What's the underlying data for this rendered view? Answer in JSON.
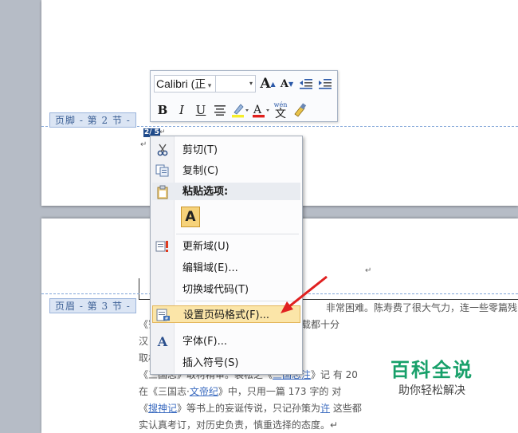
{
  "document": {
    "footer_tag": "页脚 - 第 2 节 -",
    "header_tag": "页眉 - 第 3 节 -",
    "page_number": "2/ 5",
    "para_mark": "↵",
    "text_lines": [
      {
        "parts": [
          {
            "t": "非常困难。陈寿费了很大气力，连一些零篇残",
            "link": false
          }
        ],
        "indent": 235
      },
      {
        "parts": [
          {
            "t": "《",
            "link": false
          },
          {
            "t": "",
            "link": false
          },
          {
            "t": "蜀书》中的许多重要人物的事迹，记载都十分",
            "link": false
          }
        ],
        "indent": 0
      },
      {
        "parts": [
          {
            "t": "汉",
            "link": false
          },
          {
            "t": "                   ",
            "link": false
          },
          {
            "t": "乏的。↵",
            "link": false
          }
        ],
        "indent": 0
      },
      {
        "parts": [
          {
            "t": "取材精审",
            "link": false
          }
        ],
        "indent": 0
      },
      {
        "parts": [
          {
            "t": "《三国志》取材精审。裴松之《",
            "link": false
          },
          {
            "t": "三国志注",
            "link": true
          },
          {
            "t": "》记",
            "link": false
          },
          {
            "t": "                         有 20",
            "link": false
          }
        ],
        "indent": 0
      },
      {
        "parts": [
          {
            "t": "在《三国志·",
            "link": false
          },
          {
            "t": "文帝纪",
            "link": true
          },
          {
            "t": "》中，只用一篇 173 字的",
            "link": false
          },
          {
            "t": "                         对",
            "link": false
          }
        ],
        "indent": 0
      },
      {
        "parts": [
          {
            "t": "《",
            "link": false
          },
          {
            "t": "搜神记",
            "link": true
          },
          {
            "t": "》等书上的妄诞传说，只记孙策为",
            "link": false
          },
          {
            "t": "许",
            "link": true
          },
          {
            "t": "                         这些都",
            "link": false
          }
        ],
        "indent": 0
      },
      {
        "parts": [
          {
            "t": "实认真考订，对历史负责，慎重选择的态度。↵",
            "link": false
          }
        ],
        "indent": 0
      }
    ]
  },
  "mini_toolbar": {
    "font_name": "Calibri (正",
    "font_size": "",
    "bold": "B",
    "italic": "I",
    "underline": "U",
    "grow_font": "A",
    "shrink_font": "A",
    "phonetic": "文",
    "phonetic_top": "wén"
  },
  "context_menu": {
    "items": [
      {
        "label": "剪切(T)",
        "icon": "scissors-icon"
      },
      {
        "label": "复制(C)",
        "icon": "copy-icon"
      },
      {
        "label": "粘贴选项:",
        "icon": "clipboard-icon"
      },
      {
        "label": "更新域(U)",
        "icon": "update-field-icon"
      },
      {
        "label": "编辑域(E)...",
        "icon": ""
      },
      {
        "label": "切换域代码(T)",
        "icon": ""
      },
      {
        "label": "设置页码格式(F)...",
        "icon": "page-number-format-icon"
      },
      {
        "label": "字体(F)...",
        "icon": "font-icon"
      },
      {
        "label": "插入符号(S)",
        "icon": ""
      }
    ],
    "paste_keep_text": "A"
  },
  "watermark": {
    "title": "百科全说",
    "subtitle": "助你轻松解决"
  },
  "colors": {
    "highlight": "#fbe5a8",
    "arrow": "#e02020",
    "watermark_green": "#18a06a"
  }
}
